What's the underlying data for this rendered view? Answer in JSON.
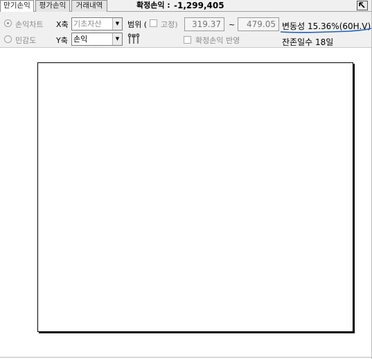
{
  "tabs": [
    {
      "label": "만기손익",
      "active": true
    },
    {
      "label": "평가손익",
      "active": false
    },
    {
      "label": "거래내역",
      "active": false
    }
  ],
  "header": {
    "confirmed_pl_label": "확정손익 :",
    "confirmed_pl_value": "-1,299,405",
    "corner_icon": "expand-arrow-icon"
  },
  "mode": {
    "options": [
      {
        "label": "손익차트",
        "selected": true
      },
      {
        "label": "민감도",
        "selected": false
      }
    ]
  },
  "axes": {
    "x_label": "X축",
    "x_value": "기초자산",
    "y_label": "Y축",
    "y_value": "손익"
  },
  "range": {
    "label": "범위 (",
    "fixed_label": "고정)",
    "fixed_checked": false,
    "from": "319.37",
    "separator": "~",
    "to": "479.05"
  },
  "reflect": {
    "label": "확정손익 반영",
    "checked": false
  },
  "volatility": {
    "label": "변동성",
    "value": "15.36%(60H.V)"
  },
  "remaining": {
    "label": "잔존일수",
    "value": "18일"
  },
  "colors": {
    "underline": "#1f5fbf",
    "toolbar_bg": "#f0f0f0",
    "tab_bg": "#e4e4e4"
  }
}
